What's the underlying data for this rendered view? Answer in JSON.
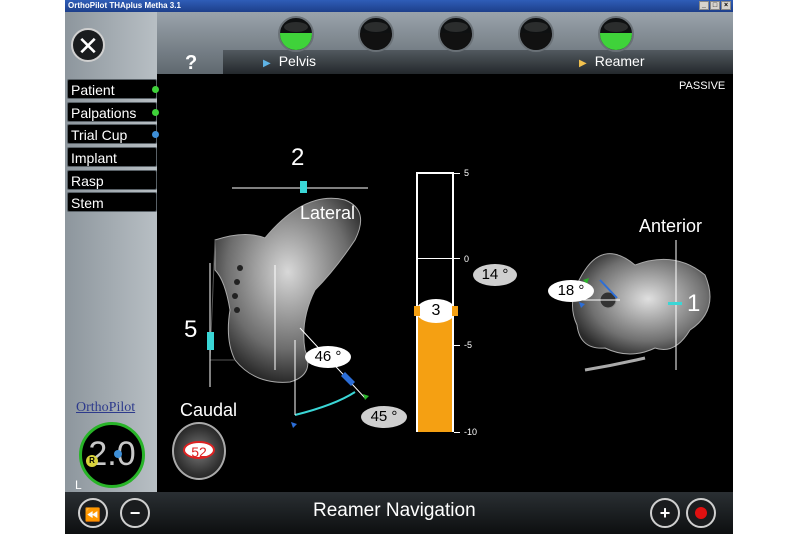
{
  "window": {
    "title": "OrthoPilot THAplus Metha 3.1"
  },
  "toolbar": {
    "close_label": "✕",
    "help_label": "?",
    "indicators": [
      {
        "name": "led-1",
        "state": "on"
      },
      {
        "name": "led-2",
        "state": "off"
      },
      {
        "name": "led-3",
        "state": "off"
      },
      {
        "name": "led-4",
        "state": "off"
      },
      {
        "name": "led-5",
        "state": "on"
      }
    ],
    "trackers": [
      {
        "label": "Pelvis",
        "color": "#5fb4e6"
      },
      {
        "label": "Reamer",
        "color": "#f2c14e"
      }
    ],
    "mode": "PASSIVE"
  },
  "sidebar": {
    "items": [
      {
        "label": "Patient",
        "status_color": "#3fd23a"
      },
      {
        "label": "Palpations",
        "status_color": "#3fd23a"
      },
      {
        "label": "Trial Cup",
        "status_color": "#3e8fd8"
      },
      {
        "label": "Implant",
        "status_color": ""
      },
      {
        "label": "Rasp",
        "status_color": ""
      },
      {
        "label": "Stem",
        "status_color": ""
      }
    ],
    "logo_text": "OrthoPilot",
    "gauge": {
      "value": "2.0",
      "side": "L",
      "badge": "R"
    }
  },
  "main": {
    "lateral_view": {
      "top_value": "2",
      "top_label": "Lateral",
      "left_value": "5",
      "bottom_label": "Caudal",
      "inclination": "46 °",
      "target_inclination": "45 °",
      "reamer_size": "52"
    },
    "depth_bar": {
      "value": "3",
      "ticks": [
        "5",
        "0",
        "-5",
        "-10"
      ],
      "depth_mm": 3
    },
    "anterior_view": {
      "label": "Anterior",
      "value": "1",
      "target_anteversion": "14 °",
      "anteversion": "18 °"
    }
  },
  "footer": {
    "title": "Reamer Navigation",
    "rewind_icon": "⏪",
    "minus_icon": "−",
    "plus_icon": "+"
  }
}
